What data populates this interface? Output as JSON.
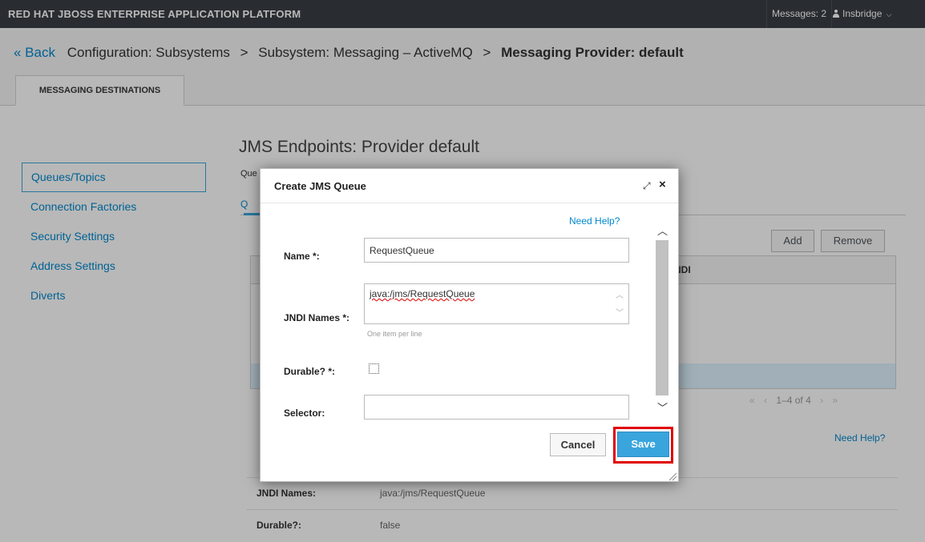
{
  "app": {
    "brand": "RED HAT JBOSS ENTERPRISE APPLICATION PLATFORM",
    "messages": "Messages: 2",
    "user": "Insbridge"
  },
  "breadcrumb": {
    "back": "« Back",
    "items": [
      "Configuration: Subsystems",
      "Subsystem: Messaging – ActiveMQ"
    ],
    "current": "Messaging Provider: default",
    "separator": ">"
  },
  "tabs": [
    "MESSAGING DESTINATIONS"
  ],
  "sidebar": {
    "items": [
      {
        "label": "Queues/Topics",
        "active": true
      },
      {
        "label": "Connection Factories"
      },
      {
        "label": "Security Settings"
      },
      {
        "label": "Address Settings"
      },
      {
        "label": "Diverts"
      }
    ]
  },
  "main": {
    "title": "JMS Endpoints: Provider default",
    "desc_visible": "Que",
    "subtab_visible": "Q",
    "add_label": "Add",
    "remove_label": "Remove",
    "table_header_jndi": "NDI",
    "pager": {
      "text": "1–4 of 4",
      "first": "«",
      "prev": "‹",
      "next": "›",
      "last": "»"
    },
    "need_help": "Need Help?",
    "details": [
      {
        "label": "JNDI Names:",
        "value": "java:/jms/RequestQueue"
      },
      {
        "label": "Durable?:",
        "value": "false"
      }
    ]
  },
  "modal": {
    "title": "Create JMS Queue",
    "need_help": "Need Help?",
    "fields": {
      "name_label": "Name *:",
      "name_value": "RequestQueue",
      "jndi_label": "JNDI Names *:",
      "jndi_value": "java:/jms/RequestQueue",
      "jndi_hint": "One item per line",
      "durable_label": "Durable? *:",
      "durable_checked": false,
      "selector_label": "Selector:",
      "selector_value": ""
    },
    "cancel_label": "Cancel",
    "save_label": "Save"
  },
  "colors": {
    "topbar": "#393f44",
    "link": "#0088ce",
    "primary_button": "#39a5dc",
    "highlight_frame": "#e00000"
  }
}
